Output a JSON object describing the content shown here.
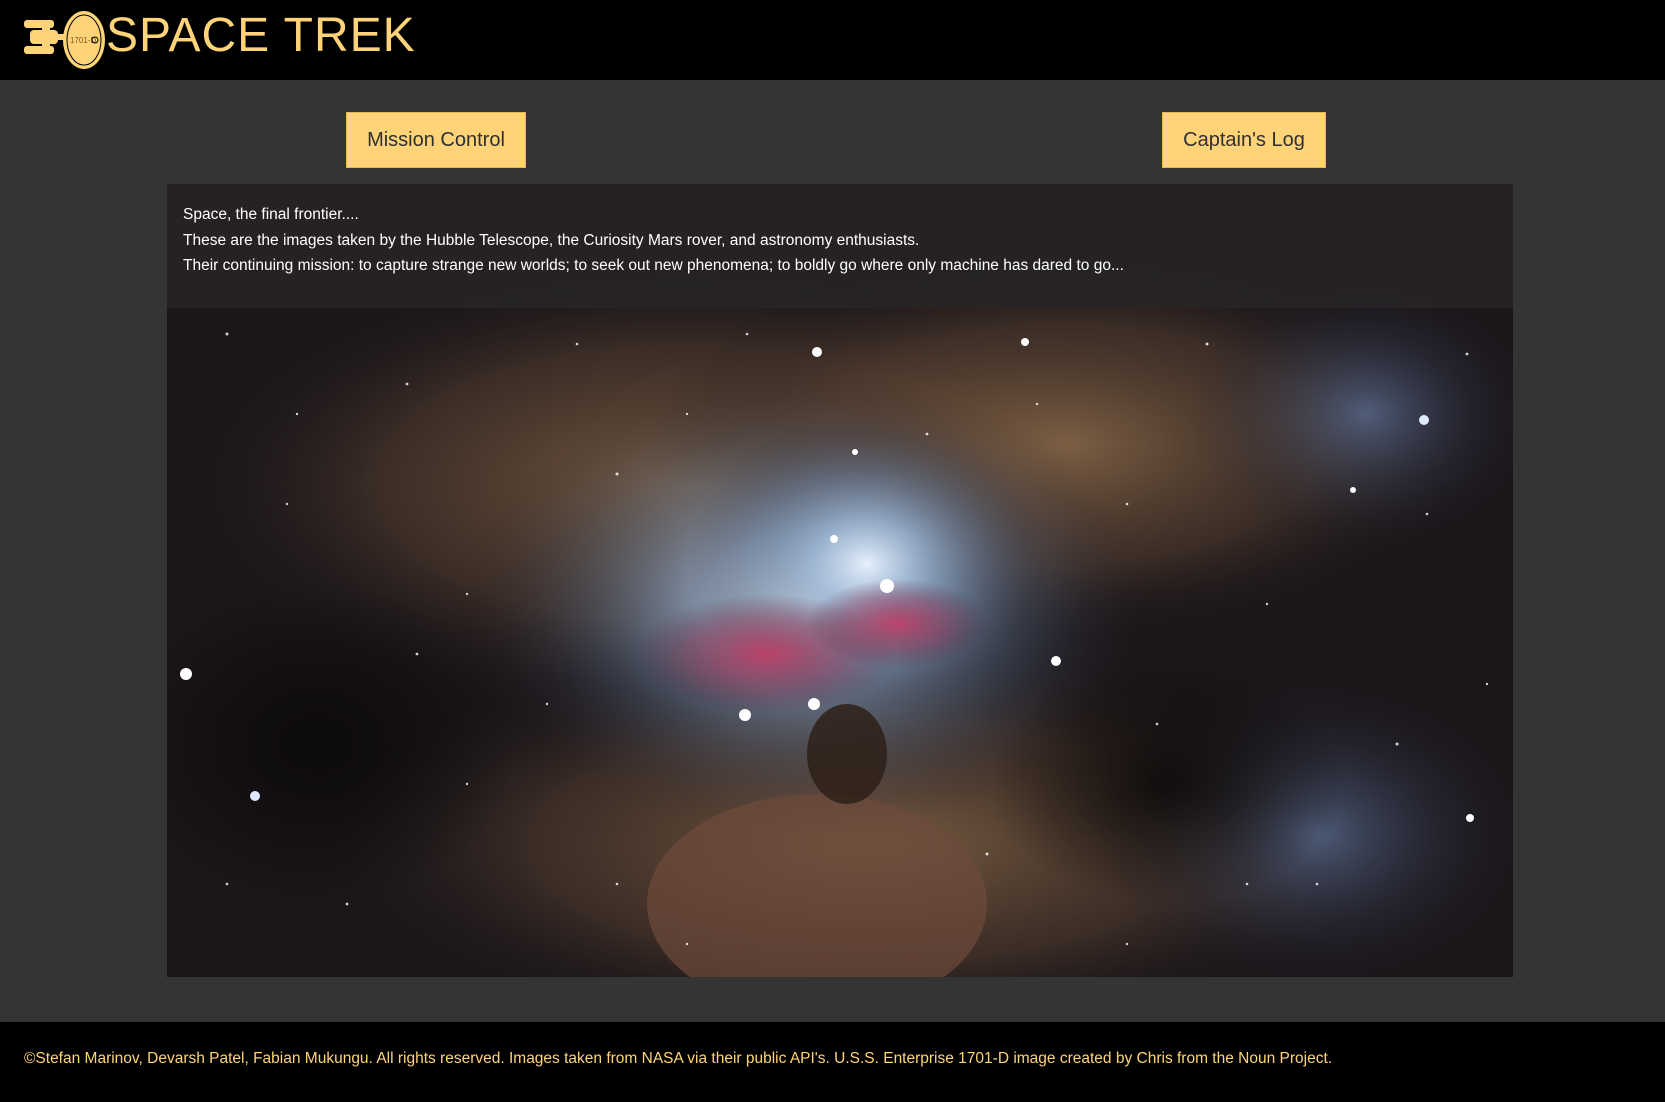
{
  "header": {
    "title": "SPACE TREK",
    "logo_icon": "starship-enterprise-icon",
    "logo_text": "1701-D",
    "accent_color": "#ffd479",
    "background_color": "#000000"
  },
  "nav": {
    "mission_control": "Mission Control",
    "captains_log": "Captain's Log"
  },
  "intro": {
    "lines": [
      "Space, the final frontier....",
      "These are the images taken by the Hubble Telescope, the Curiosity Mars rover, and astronomy enthusiasts.",
      "Their continuing mission: to capture strange new worlds; to seek out new phenomena; to boldly go where only machine has dared to go..."
    ]
  },
  "hero_image": {
    "subject": "nebula"
  },
  "footer": {
    "copyright": "©Stefan Marinov, Devarsh Patel, Fabian Mukungu. All rights reserved. Images taken from NASA via their public API's. U.S.S. Enterprise 1701-D image created by Chris from the Noun Project."
  },
  "colors": {
    "page_background": "#353434",
    "button_background": "#ffd479",
    "button_text": "#2f2f2f"
  }
}
